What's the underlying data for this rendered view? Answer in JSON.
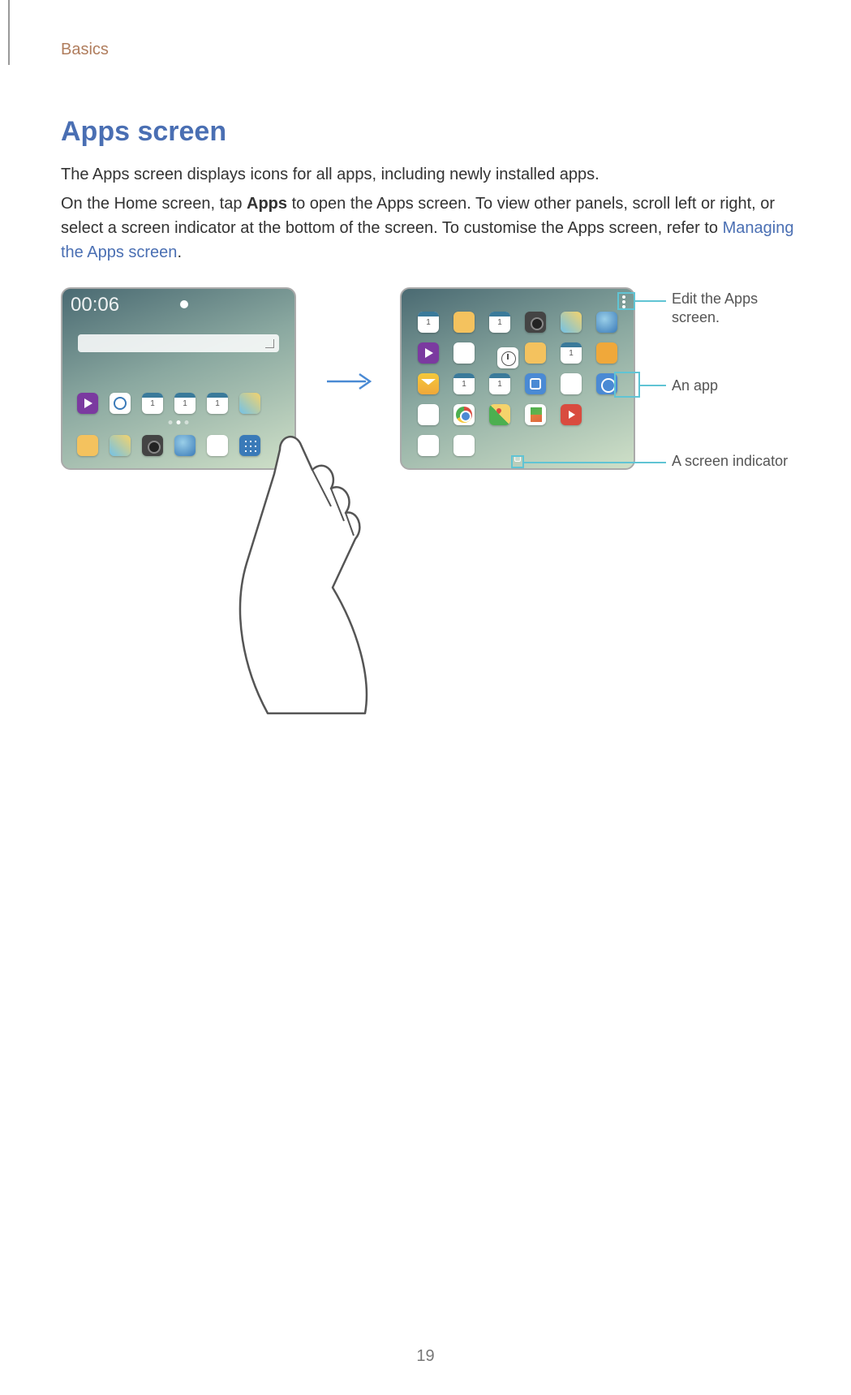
{
  "chapter": "Basics",
  "heading": "Apps screen",
  "para1": "The Apps screen displays icons for all apps, including newly installed apps.",
  "para2_a": "On the Home screen, tap ",
  "para2_bold": "Apps",
  "para2_b": " to open the Apps screen. To view other panels, scroll left or right, or select a screen indicator at the bottom of the screen. To customise the Apps screen, refer to ",
  "para2_link": "Managing the Apps screen",
  "para2_c": ".",
  "home_clock": "00:06",
  "callouts": {
    "edit": "Edit the Apps screen.",
    "app": "An app",
    "indicator": "A screen indicator"
  },
  "page_number": "19"
}
